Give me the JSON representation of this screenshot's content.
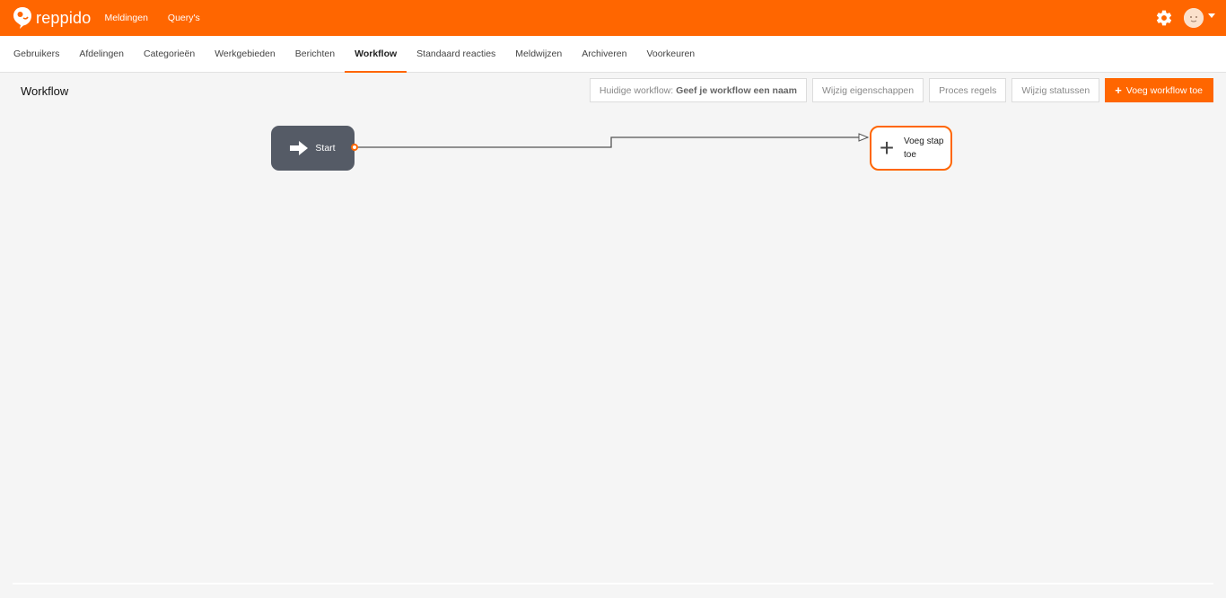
{
  "app": {
    "logo_text": "reppido"
  },
  "top_nav": [
    {
      "label": "Meldingen"
    },
    {
      "label": "Query's"
    }
  ],
  "top_right": {
    "settings_icon": "gear-icon",
    "avatar_icon": "avatar-face",
    "dropdown_icon": "caret-down"
  },
  "tabs": [
    {
      "label": "Gebruikers"
    },
    {
      "label": "Afdelingen"
    },
    {
      "label": "Categorieën"
    },
    {
      "label": "Werkgebieden"
    },
    {
      "label": "Berichten"
    },
    {
      "label": "Workflow",
      "active": true
    },
    {
      "label": "Standaard reacties"
    },
    {
      "label": "Meldwijzen"
    },
    {
      "label": "Archiveren"
    },
    {
      "label": "Voorkeuren"
    }
  ],
  "page": {
    "title": "Workflow"
  },
  "toolbar": {
    "current_workflow_prefix": "Huidige workflow:",
    "current_workflow_name": "Geef je workflow een naam",
    "edit_properties": "Wijzig eigenschappen",
    "process_rules": "Proces regels",
    "edit_statuses": "Wijzig statussen",
    "add_workflow": "Voeg workflow toe"
  },
  "canvas": {
    "start_label": "Start",
    "add_step_label": "Voeg stap toe"
  },
  "colors": {
    "accent": "#ff6600",
    "start_node": "#555b66"
  }
}
